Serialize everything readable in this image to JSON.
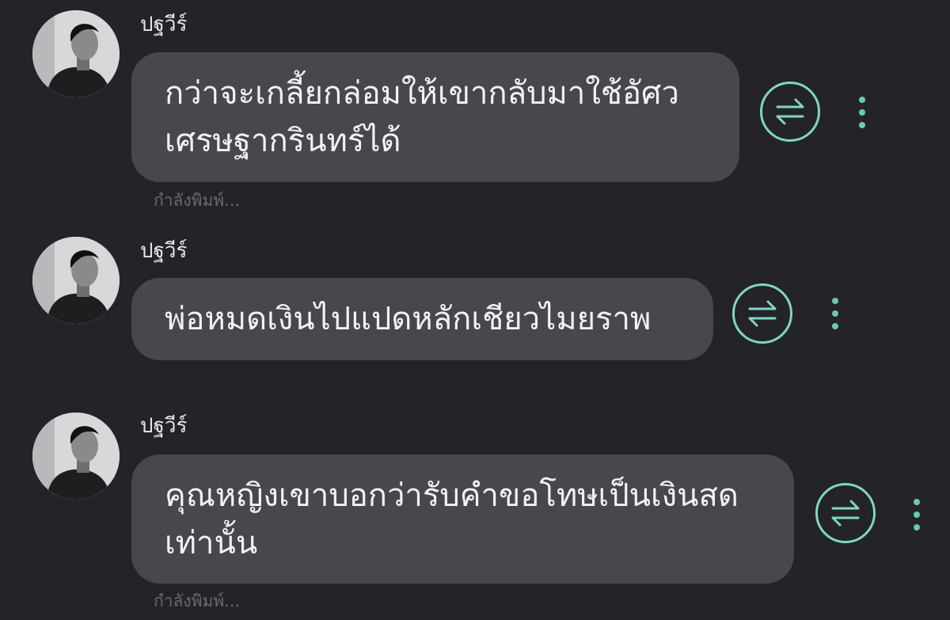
{
  "messages": [
    {
      "sender": "ปฐวีร์",
      "lines": [
        "กว่าจะเกลี้ยกล่อมให้เขากลับมาใช้อัศว",
        "เศรษฐากรินทร์ได้"
      ],
      "status": "กำลังพิมพ์...",
      "avatar_icon": "profile-photo",
      "translate_icon": "translate-arrows-icon",
      "menu_icon": "more-vertical-icon"
    },
    {
      "sender": "ปฐวีร์",
      "lines": [
        "พ่อหมดเงินไปแปดหลักเชียวไมยราพ"
      ],
      "avatar_icon": "profile-photo",
      "translate_icon": "translate-arrows-icon",
      "menu_icon": "more-vertical-icon"
    },
    {
      "sender": "ปฐวีร์",
      "lines": [
        "คุณหญิงเขาบอกว่ารับคำขอโทษเป็นเงินสด",
        "เท่านั้น"
      ],
      "status": "กำลังพิมพ์...",
      "avatar_icon": "profile-photo",
      "translate_icon": "translate-arrows-icon",
      "menu_icon": "more-vertical-icon"
    }
  ],
  "colors": {
    "background": "#242329",
    "bubble": "#48474d",
    "accent": "#7fd6c2",
    "status_text": "#6a696f"
  }
}
